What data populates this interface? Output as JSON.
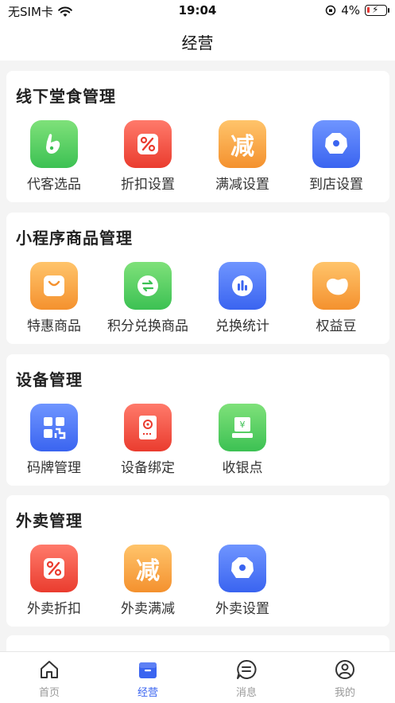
{
  "status_bar": {
    "carrier": "无SIM卡",
    "time": "19:04",
    "battery_percent": "4%"
  },
  "nav": {
    "title": "经营"
  },
  "sections": [
    {
      "title": "线下堂食管理",
      "items": [
        {
          "label": "代客选品",
          "icon": "hand-pointer-icon",
          "color": "#3cc153"
        },
        {
          "label": "折扣设置",
          "icon": "percent-icon",
          "color": "#ea3c2f"
        },
        {
          "label": "满减设置",
          "icon": "reduce-char-icon",
          "color": "#f4912e"
        },
        {
          "label": "到店设置",
          "icon": "octagon-settings-icon",
          "color": "#3a64f0"
        }
      ]
    },
    {
      "title": "小程序商品管理",
      "items": [
        {
          "label": "特惠商品",
          "icon": "shopping-bag-icon",
          "color": "#f4912e"
        },
        {
          "label": "积分兑换商品",
          "icon": "exchange-icon",
          "color": "#3cc153"
        },
        {
          "label": "兑换统计",
          "icon": "bar-chart-icon",
          "color": "#3a64f0"
        },
        {
          "label": "权益豆",
          "icon": "bean-icon",
          "color": "#f4912e"
        }
      ]
    },
    {
      "title": "设备管理",
      "items": [
        {
          "label": "码牌管理",
          "icon": "qr-code-icon",
          "color": "#3a64f0"
        },
        {
          "label": "设备绑定",
          "icon": "device-icon",
          "color": "#ea3c2f"
        },
        {
          "label": "收银点",
          "icon": "cashier-icon",
          "color": "#3cc153"
        }
      ]
    },
    {
      "title": "外卖管理",
      "items": [
        {
          "label": "外卖折扣",
          "icon": "percent-icon",
          "color": "#ea3c2f"
        },
        {
          "label": "外卖满减",
          "icon": "reduce-char-icon",
          "color": "#f4912e"
        },
        {
          "label": "外卖设置",
          "icon": "octagon-settings-icon",
          "color": "#3a64f0"
        }
      ]
    }
  ],
  "tabs": [
    {
      "label": "首页",
      "icon": "home-icon",
      "active": false
    },
    {
      "label": "经营",
      "icon": "briefcase-icon",
      "active": true
    },
    {
      "label": "消息",
      "icon": "message-icon",
      "active": false
    },
    {
      "label": "我的",
      "icon": "profile-icon",
      "active": false
    }
  ]
}
